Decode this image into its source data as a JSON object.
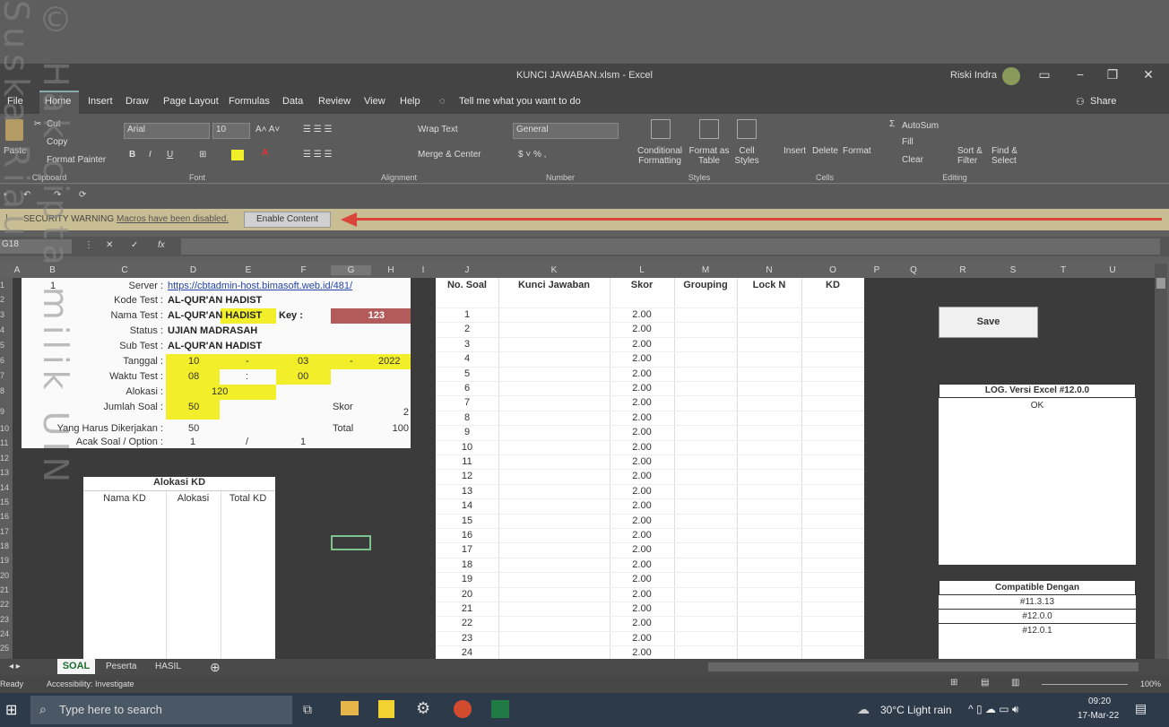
{
  "title": "KUNCI JAWABAN.xlsm - Excel",
  "user": "Riski Indra",
  "menu": [
    "File",
    "Home",
    "Insert",
    "Draw",
    "Page Layout",
    "Formulas",
    "Data",
    "Review",
    "View",
    "Help"
  ],
  "tell_me": "Tell me what you want to do",
  "share": "Share",
  "ribbon": {
    "paste": "Paste",
    "cut": "Cut",
    "copy": "Copy",
    "format_painter": "Format Painter",
    "font_name": "Arial",
    "font_size": "10",
    "wrap_text": "Wrap Text",
    "merge_center": "Merge & Center",
    "number_format": "General",
    "conditional_formatting": "Conditional Formatting",
    "format_as_table": "Format as Table",
    "cell_styles": "Cell Styles",
    "insert": "Insert",
    "delete": "Delete",
    "format": "Format",
    "autosum": "AutoSum",
    "fill": "Fill",
    "clear": "Clear",
    "sort_filter": "Sort & Filter",
    "find_select": "Find & Select",
    "groups": [
      "Clipboard",
      "Font",
      "Alignment",
      "Number",
      "Styles",
      "Cells",
      "Editing"
    ]
  },
  "security": {
    "title": "SECURITY WARNING",
    "message": "Macros have been disabled.",
    "button": "Enable Content"
  },
  "name_box": "G18",
  "columns": [
    "A",
    "B",
    "C",
    "D",
    "E",
    "F",
    "G",
    "H",
    "I",
    "J",
    "K",
    "L",
    "M",
    "N",
    "O",
    "P",
    "Q",
    "R",
    "S",
    "T",
    "U"
  ],
  "rows": [
    "1",
    "2",
    "3",
    "4",
    "5",
    "6",
    "7",
    "8",
    "9",
    "10",
    "11",
    "12",
    "13",
    "14",
    "15",
    "16",
    "17",
    "18",
    "19",
    "20",
    "21",
    "22",
    "23",
    "24",
    "25"
  ],
  "panel": {
    "b1": "1",
    "server_label": "Server :",
    "server_value": "https://cbtadmin-host.bimasoft.web.id/481/",
    "kode_label": "Kode Test :",
    "kode_value": "AL-QUR'AN HADIST",
    "nama_label": "Nama Test :",
    "nama_value": "AL-QUR'AN HADIST",
    "key_label": "Key :",
    "key_value": "123",
    "status_label": "Status :",
    "status_value": "UJIAN MADRASAH",
    "subtest_label": "Sub Test :",
    "subtest_value": "AL-QUR'AN HADIST",
    "tanggal_label": "Tanggal :",
    "tgl_d": "10",
    "tgl_sep1": "-",
    "tgl_m": "03",
    "tgl_sep2": "-",
    "tgl_y": "2022",
    "waktu_label": "Waktu Test :",
    "waktu_h": "08",
    "waktu_sep": ":",
    "waktu_m": "00",
    "alokasi_label": "Alokasi :",
    "alokasi_value": "120",
    "jumlah_label": "Jumlah Soal :",
    "jumlah_value": "50",
    "skor_label": "Skor",
    "skor_value": "2",
    "harus_label": "Yang Harus Dikerjakan :",
    "harus_value": "50",
    "total_label": "Total",
    "total_value": "100",
    "acak_label": "Acak Soal / Option :",
    "acak_a": "1",
    "acak_sep": "/",
    "acak_b": "1"
  },
  "kd": {
    "title": "Alokasi KD",
    "headers": [
      "Nama KD",
      "Alokasi",
      "Total KD"
    ]
  },
  "table": {
    "headers": [
      "No. Soal",
      "Kunci Jawaban",
      "Skor",
      "Grouping",
      "Lock N",
      "KD"
    ],
    "numbers": [
      "1",
      "2",
      "3",
      "4",
      "5",
      "6",
      "7",
      "8",
      "9",
      "10",
      "11",
      "12",
      "13",
      "14",
      "15",
      "16",
      "17",
      "18",
      "19",
      "20",
      "21",
      "22",
      "23",
      "24"
    ],
    "skor": "2.00"
  },
  "save_label": "Save",
  "log": {
    "title": "LOG. Versi Excel #12.0.0",
    "value": "OK"
  },
  "compat": {
    "title": "Compatible Dengan",
    "items": [
      "#11.3.13",
      "#12.0.0",
      "#12.0.1"
    ]
  },
  "sheets": [
    "SOAL",
    "Peserta",
    "HASIL"
  ],
  "status": {
    "ready": "Ready",
    "accessibility": "Accessibility: Investigate",
    "zoom": "100%"
  },
  "taskbar": {
    "search": "Type here to search",
    "weather": "30°C Light rain",
    "time": "09:20",
    "date": "17-Mar-22"
  },
  "watermark": "© Hak cipta milik UIN Suska Riau"
}
